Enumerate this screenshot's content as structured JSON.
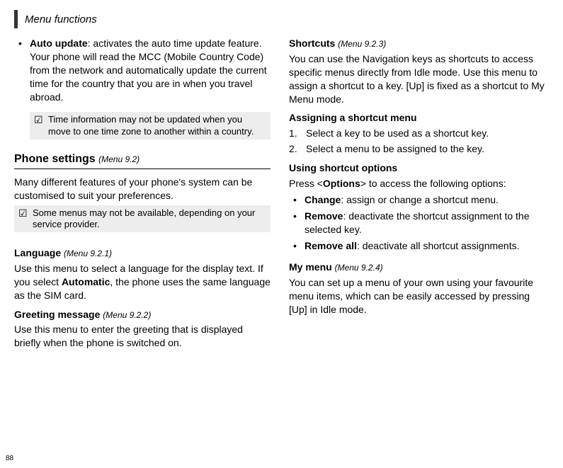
{
  "header": {
    "title": "Menu functions"
  },
  "page_number": "88",
  "col1": {
    "auto_update": {
      "bullet": "•",
      "label": "Auto update",
      "text": ": activates the auto time update feature. Your phone will read the MCC (Mobile Country Code) from the network and automatically update the current time for the country that you are in when you travel abroad."
    },
    "note1": {
      "icon": "☑",
      "text": "Time information may not be updated when you move to one time zone to another within a country."
    },
    "phone_settings": {
      "title": "Phone settings",
      "menu_ref": "(Menu 9.2)",
      "intro": "Many different features of your phone's system can be customised to suit your preferences."
    },
    "note2": {
      "icon": "☑",
      "text": "Some menus may not be available, depending on your service provider."
    },
    "language": {
      "title": "Language",
      "menu_ref": "(Menu 9.2.1)",
      "text_pre": "Use this menu to select a language for the display text. If you select ",
      "text_bold": "Automatic",
      "text_post": ", the phone uses the same language as the SIM card."
    },
    "greeting": {
      "title": "Greeting message",
      "menu_ref": "(Menu 9.2.2)",
      "text": "Use this menu to enter the greeting that is displayed briefly when the phone is switched on."
    }
  },
  "col2": {
    "shortcuts": {
      "title": "Shortcuts",
      "menu_ref": "(Menu 9.2.3)",
      "intro": "You can use the Navigation keys as shortcuts to access specific menus directly from Idle mode. Use this menu to assign a shortcut to a key. [Up] is fixed as a shortcut to My Menu mode.",
      "assign_heading": "Assigning a shortcut menu",
      "step1_num": "1.",
      "step1": "Select a key to be used as a shortcut key.",
      "step2_num": "2.",
      "step2": "Select a menu to be assigned to the key.",
      "using_heading": "Using shortcut options",
      "press_pre": "Press <",
      "press_bold": "Options",
      "press_post": "> to access the following options:",
      "opts": {
        "bullet": "•",
        "change_label": "Change",
        "change_text": ": assign or change a shortcut menu.",
        "remove_label": "Remove",
        "remove_text": ": deactivate the shortcut assignment to the selected key.",
        "removeall_label": "Remove all",
        "removeall_text": ": deactivate all shortcut assignments."
      }
    },
    "mymenu": {
      "title": "My menu",
      "menu_ref": "(Menu 9.2.4)",
      "text": "You can set up a menu of your own using your favourite menu items, which can be easily accessed by pressing [Up] in Idle mode."
    }
  }
}
